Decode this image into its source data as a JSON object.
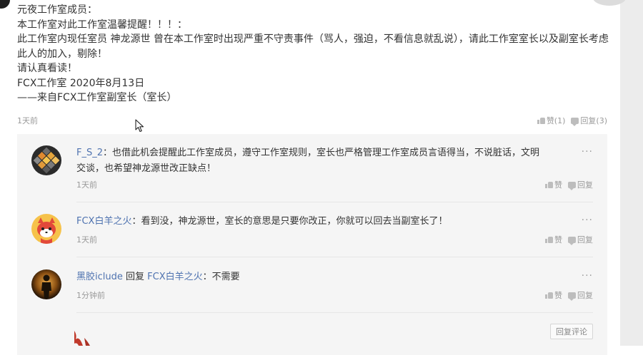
{
  "post": {
    "lines": [
      "元夜工作室成员：",
      "本工作室对此工作室温馨提醒！！！：",
      "此工作室内现任室员 神龙源世 曾在本工作室时出现严重不守责事件（骂人，强迫，不看信息就乱说），请此工作室室长以及副室长考虑此人的加入，剔除！",
      "请认真看读！",
      "FCX工作室 2020年8月13日",
      "——来自FCX工作室副室长（室长）"
    ],
    "time": "1天前",
    "like_label": "赞(1)",
    "reply_label": "回复(3)"
  },
  "replies": [
    {
      "username": "F_S_2",
      "separator": "：",
      "text": "也借此机会提醒此工作室成员，遵守工作室规则，室长也严格管理工作室成员言语得当，不说脏话，文明交谈，也希望神龙源世改正缺点！",
      "time": "1天前",
      "like": "赞",
      "reply": "回复",
      "more": "···",
      "avatar": "cube-avatar"
    },
    {
      "username": "FCX白羊之火",
      "separator": "：",
      "text": "看到没，神龙源世，室长的意思是只要你改正，你就可以回去当副室长了！",
      "time": "1天前",
      "like": "赞",
      "reply": "回复",
      "more": "···",
      "avatar": "fox-avatar"
    },
    {
      "username": "黑胶iclude",
      "mid": " 回复 ",
      "target": "FCX白羊之火",
      "separator": "：",
      "text": "不需要",
      "time": "1分钟前",
      "like": "赞",
      "reply": "回复",
      "more": "···",
      "avatar": "silhouette-avatar"
    }
  ],
  "reply_comment_button": "回复评论",
  "colors": {
    "username": "#4f73b0",
    "muted": "#9a9a9a",
    "panel": "#f5f5f5"
  }
}
